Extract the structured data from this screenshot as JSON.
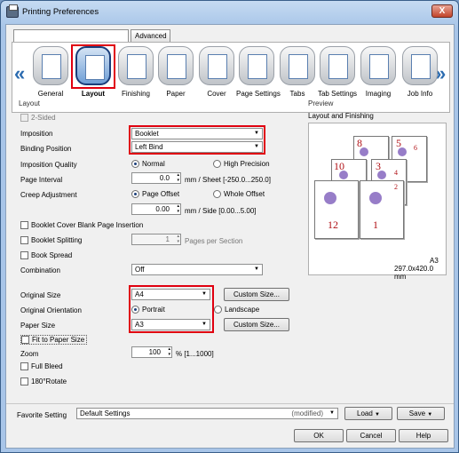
{
  "window": {
    "title": "Printing Preferences",
    "close_label": "X"
  },
  "tabs": {
    "advanced": "Advanced"
  },
  "icon_tabs": [
    {
      "label": "General",
      "icon": "printer-icon"
    },
    {
      "label": "Layout",
      "icon": "layout-icon",
      "selected": true
    },
    {
      "label": "Finishing",
      "icon": "finishing-icon"
    },
    {
      "label": "Paper",
      "icon": "paper-icon"
    },
    {
      "label": "Cover",
      "icon": "cover-icon"
    },
    {
      "label": "Page Settings",
      "icon": "page-settings-icon"
    },
    {
      "label": "Tabs",
      "icon": "tabs-icon"
    },
    {
      "label": "Tab Settings",
      "icon": "tab-settings-icon"
    },
    {
      "label": "Imaging",
      "icon": "imaging-icon"
    },
    {
      "label": "Job Info",
      "icon": "job-info-icon"
    }
  ],
  "nav": {
    "left": "«",
    "right": "»"
  },
  "layout": {
    "group": "Layout",
    "two_sided": "2-Sided",
    "imposition_label": "Imposition",
    "imposition_value": "Booklet",
    "binding_label": "Binding Position",
    "binding_value": "Left Bind",
    "quality_label": "Imposition Quality",
    "quality_normal": "Normal",
    "quality_high": "High Precision",
    "interval_label": "Page Interval",
    "interval_value": "0.0",
    "interval_unit": "mm / Sheet [-250.0...250.0]",
    "creep_label": "Creep Adjustment",
    "creep_page_offset": "Page Offset",
    "creep_whole_offset": "Whole Offset",
    "creep_value": "0.00",
    "creep_unit": "mm / Side [0.00...5.00]",
    "blank_insertion": "Booklet Cover Blank Page Insertion",
    "splitting": "Booklet Splitting",
    "split_value": "1",
    "split_unit": "Pages per Section",
    "book_spread": "Book Spread",
    "combination_label": "Combination",
    "combination_value": "Off",
    "original_size_label": "Original Size",
    "original_size_value": "A4",
    "custom_size_1": "Custom Size...",
    "orientation_label": "Original Orientation",
    "portrait": "Portrait",
    "landscape": "Landscape",
    "paper_size_label": "Paper Size",
    "paper_size_value": "A3",
    "custom_size_2": "Custom Size...",
    "fit_to_paper": "Fit to Paper Size",
    "zoom_label": "Zoom",
    "zoom_value": "100",
    "zoom_unit": "% [1...1000]",
    "full_bleed": "Full Bleed",
    "rotate_180": "180°Rotate"
  },
  "preview": {
    "group": "Preview",
    "title": "Layout and Finishing",
    "pages": [
      "8",
      "5",
      "6",
      "10",
      "3",
      "4",
      "12",
      "1",
      "2"
    ],
    "paper": "A3",
    "paper_dims": "297.0x420.0 mm"
  },
  "footer": {
    "favorite_label": "Favorite Setting",
    "favorite_value": "Default Settings",
    "modified": "(modified)",
    "load": "Load",
    "save": "Save",
    "ok": "OK",
    "cancel": "Cancel",
    "help": "Help"
  }
}
